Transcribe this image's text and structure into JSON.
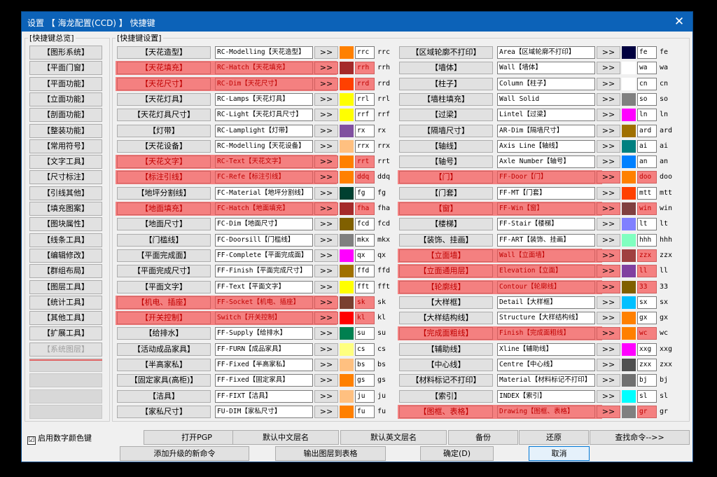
{
  "window": {
    "title": "设置 【 海龙配置(CCD) 】 快捷键",
    "close_glyph": "✕"
  },
  "summary_group_label": "[快捷键总览]",
  "settings_group_label": "[快捷键设置]",
  "sidebar": [
    "【图形系统】",
    "【平面门窗】",
    "【平面功能】",
    "【立面功能】",
    "【剖面功能】",
    "【整装功能】",
    "【常用符号】",
    "【文字工具】",
    "【尺寸标注】",
    "【引线其他】",
    "【填充图案】",
    "【图块属性】",
    "【线条工具】",
    "【编辑修改】",
    "【群组布局】",
    "【图层工具】",
    "【统计工具】",
    "【其他工具】",
    "【扩展工具】",
    "【系统图层】"
  ],
  "arrow": ">>",
  "left_rows": [
    {
      "label": "【天花造型】",
      "cmd": "RC-Modelling【天花造型】",
      "color": "#ff8000",
      "key": "rrc",
      "disp": "rrc",
      "hl": false
    },
    {
      "label": "【天花填充】",
      "cmd": "RC-Hatch【天花填充】",
      "color": "#a52a2a",
      "key": "rrh",
      "disp": "rrh",
      "hl": true
    },
    {
      "label": "【天花尺寸】",
      "cmd": "RC-Dim【天花尺寸】",
      "color": "#ff4000",
      "key": "rrd",
      "disp": "rrd",
      "hl": true
    },
    {
      "label": "【天花灯具】",
      "cmd": "RC-Lamps【天花灯具】",
      "color": "#ffff00",
      "key": "rrl",
      "disp": "rrl",
      "hl": false
    },
    {
      "label": "【天花灯具尺寸】",
      "cmd": "RC-Light【天花灯具尺寸】",
      "color": "#ffff00",
      "key": "rrf",
      "disp": "rrf",
      "hl": false
    },
    {
      "label": "【灯带】",
      "cmd": "RC-Lamplight【灯带】",
      "color": "#8050a0",
      "key": "rx",
      "disp": "rx",
      "hl": false
    },
    {
      "label": "【天花设备】",
      "cmd": "RC-Modelling【天花设备】",
      "color": "#ffc080",
      "key": "rrx",
      "disp": "rrx",
      "hl": false
    },
    {
      "label": "【天花文字】",
      "cmd": "RC-Text【天花文字】",
      "color": "#ff8000",
      "key": "rrt",
      "disp": "rrt",
      "hl": true
    },
    {
      "label": "【标注引线】",
      "cmd": "FC-Refe【标注引线】",
      "color": "#ff8000",
      "key": "ddq",
      "disp": "ddq",
      "hl": true
    },
    {
      "label": "【地坪分割线】",
      "cmd": "FC-Material【地坪分割线】",
      "color": "#004030",
      "key": "fg",
      "disp": "fg",
      "hl": false
    },
    {
      "label": "【地面填充】",
      "cmd": "FC-Hatch【地面填充】",
      "color": "#a52a2a",
      "key": "fha",
      "disp": "fha",
      "hl": true
    },
    {
      "label": "【地面尺寸】",
      "cmd": "FC-Dim【地面尺寸】",
      "color": "#806000",
      "key": "fcd",
      "disp": "fcd",
      "hl": false
    },
    {
      "label": "【门槛线】",
      "cmd": "FC-Doorsill【门槛线】",
      "color": "#808080",
      "key": "mkx",
      "disp": "mkx",
      "hl": false
    },
    {
      "label": "【平面完成面】",
      "cmd": "FF-Complete【平面完成面】",
      "color": "#ff00ff",
      "key": "qx",
      "disp": "qx",
      "hl": false
    },
    {
      "label": "【平面完成尺寸】",
      "cmd": "FF-Finish【平面完成尺寸】",
      "color": "#a07000",
      "key": "ffd",
      "disp": "ffd",
      "hl": false
    },
    {
      "label": "【平面文字】",
      "cmd": "FF-Text【平面文字】",
      "color": "#ffff00",
      "key": "fft",
      "disp": "fft",
      "hl": false
    },
    {
      "label": "【机电、插座】",
      "cmd": "FF-Socket【机电、插座】",
      "color": "#7a4030",
      "key": "sk",
      "disp": "sk",
      "hl": true
    },
    {
      "label": "【开关控制】",
      "cmd": "Switch【开关控制】",
      "color": "#ff0000",
      "key": "kl",
      "disp": "kl",
      "hl": true
    },
    {
      "label": "【给排水】",
      "cmd": "FF-Supply【给排水】",
      "color": "#008050",
      "key": "su",
      "disp": "su",
      "hl": false
    },
    {
      "label": "【活动成品家具】",
      "cmd": "FF-FURN【成品家具】",
      "color": "#ffff80",
      "key": "cs",
      "disp": "cs",
      "hl": false
    },
    {
      "label": "【半高家私】",
      "cmd": "FF-Fixed【半高家私】",
      "color": "#ffc080",
      "key": "bs",
      "disp": "bs",
      "hl": false
    },
    {
      "label": "【固定家具(高柜)】",
      "cmd": "FF-Fixed【固定家具】",
      "color": "#ff8000",
      "key": "gs",
      "disp": "gs",
      "hl": false
    },
    {
      "label": "【洁具】",
      "cmd": "FF-FIXT【洁具】",
      "color": "#ffc080",
      "key": "ju",
      "disp": "ju",
      "hl": false
    },
    {
      "label": "【家私尺寸】",
      "cmd": "FU-DIM【家私尺寸】",
      "color": "#ff8000",
      "key": "fu",
      "disp": "fu",
      "hl": false
    }
  ],
  "right_rows": [
    {
      "label": "【区域轮廓不打印】",
      "cmd": "Area【区域轮廓不打印】",
      "color": "#000040",
      "key": "fe",
      "disp": "fe",
      "hl": false
    },
    {
      "label": "【墙体】",
      "cmd": "Wall【墙体】",
      "color": "#ffffff",
      "key": "wa",
      "disp": "wa",
      "hl": false
    },
    {
      "label": "【柱子】",
      "cmd": "Column【柱子】",
      "color": "#ffffff",
      "key": "cn",
      "disp": "cn",
      "hl": false
    },
    {
      "label": "【墙柱填充】",
      "cmd": "Wall Solid",
      "color": "#808080",
      "key": "so",
      "disp": "so",
      "hl": false
    },
    {
      "label": "【过梁】",
      "cmd": "Lintel【过梁】",
      "color": "#ff00ff",
      "key": "ln",
      "disp": "ln",
      "hl": false
    },
    {
      "label": "【隔墙尺寸】",
      "cmd": "AR-Dim【隔墙尺寸】",
      "color": "#a07000",
      "key": "ard",
      "disp": "ard",
      "hl": false
    },
    {
      "label": "【轴线】",
      "cmd": "Axis Line【轴线】",
      "color": "#008080",
      "key": "ai",
      "disp": "ai",
      "hl": false
    },
    {
      "label": "【轴号】",
      "cmd": "Axle Number【轴号】",
      "color": "#0080ff",
      "key": "an",
      "disp": "an",
      "hl": false
    },
    {
      "label": "【门】",
      "cmd": "FF-Door【门】",
      "color": "#ff8000",
      "key": "doo",
      "disp": "doo",
      "hl": true
    },
    {
      "label": "【门套】",
      "cmd": "FF-MT【门套】",
      "color": "#ff4000",
      "key": "mtt",
      "disp": "mtt",
      "hl": false
    },
    {
      "label": "【窗】",
      "cmd": "FF-Win【窗】",
      "color": "#804040",
      "key": "win",
      "disp": "win",
      "hl": true
    },
    {
      "label": "【楼梯】",
      "cmd": "FF-Stair【楼梯】",
      "color": "#8080ff",
      "key": "lt",
      "disp": "lt",
      "hl": false
    },
    {
      "label": "【装饰、挂画】",
      "cmd": "FF-ART【装饰、挂画】",
      "color": "#80ffc0",
      "key": "hhh",
      "disp": "hhh",
      "hl": false
    },
    {
      "label": "【立面墙】",
      "cmd": "Wall【立面墙】",
      "color": "#a04040",
      "key": "zzx",
      "disp": "zzx",
      "hl": true
    },
    {
      "label": "【立面通用层】",
      "cmd": "Elevation【立面】",
      "color": "#8040a0",
      "key": "ll",
      "disp": "ll",
      "hl": true
    },
    {
      "label": "【轮廓线】",
      "cmd": "Contour【轮廓线】",
      "color": "#806000",
      "key": "33",
      "disp": "33",
      "hl": true
    },
    {
      "label": "【大样框】",
      "cmd": "Detail【大样框】",
      "color": "#00c0ff",
      "key": "sx",
      "disp": "sx",
      "hl": false
    },
    {
      "label": "【大样结构线】",
      "cmd": "Structure【大样结构线】",
      "color": "#ff8000",
      "key": "gx",
      "disp": "gx",
      "hl": false
    },
    {
      "label": "【完成面粗线】",
      "cmd": "Finish【完成面粗线】",
      "color": "#ff8000",
      "key": "wc",
      "disp": "wc",
      "hl": true
    },
    {
      "label": "【辅助线】",
      "cmd": "Xline【辅助线】",
      "color": "#ff00ff",
      "key": "xxg",
      "disp": "xxg",
      "hl": false
    },
    {
      "label": "【中心线】",
      "cmd": "Centre【中心线】",
      "color": "#505050",
      "key": "zxx",
      "disp": "zxx",
      "hl": false
    },
    {
      "label": "【材料标记不打印】",
      "cmd": "Material【材料标记不打印】",
      "color": "#707070",
      "key": "bj",
      "disp": "bj",
      "hl": false
    },
    {
      "label": "【索引】",
      "cmd": "INDEX【索引】",
      "color": "#00ffff",
      "key": "sl",
      "disp": "sl",
      "hl": false
    },
    {
      "label": "【图框、表格】",
      "cmd": "Drawing【图框、表格】",
      "color": "#808080",
      "key": "gr",
      "disp": "gr",
      "hl": true
    }
  ],
  "checkbox": {
    "label": "启用数字颜色键",
    "checked": "☑"
  },
  "buttons": {
    "open_pgp": "打开PGP",
    "default_cn": "默认中文层名",
    "default_en": "默认英文层名",
    "backup": "备份",
    "restore": "还原",
    "find": "查找命令-->>",
    "add_cmd": "添加升级的新命令",
    "export": "输出图层到表格",
    "ok": "确定(D)",
    "cancel": "取消"
  }
}
